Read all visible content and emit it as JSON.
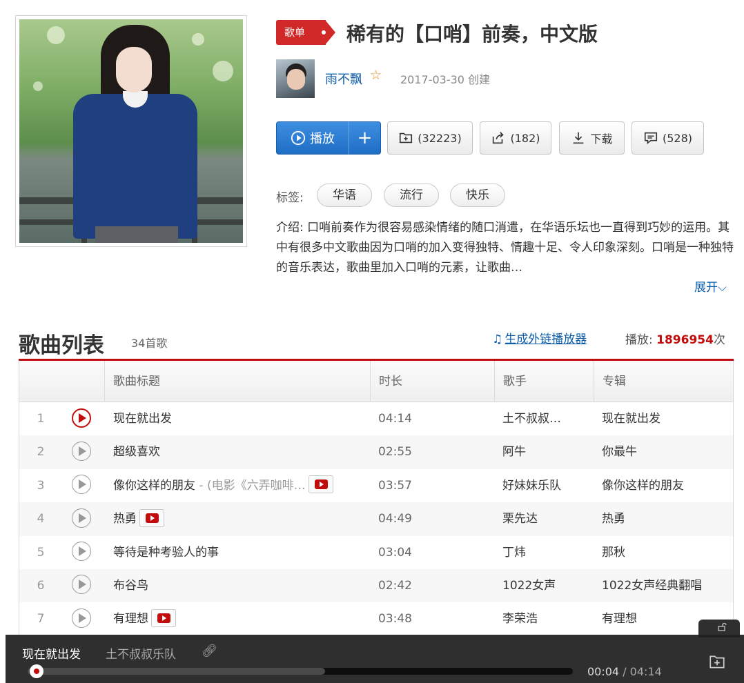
{
  "playlist": {
    "badge": "歌单",
    "title": "稀有的【口哨】前奏，中文版",
    "creator": {
      "name": "雨不飘",
      "created": "2017-03-30 创建"
    },
    "actions": {
      "play": "播放",
      "add": "+",
      "favorite": "(32223)",
      "share": "(182)",
      "download": "下载",
      "comment": "(528)"
    },
    "tags_label": "标签:",
    "tags": [
      "华语",
      "流行",
      "快乐"
    ],
    "intro": "介绍:  口哨前奏作为很容易感染情绪的随口消遣，在华语乐坛也一直得到巧妙的运用。其中有很多中文歌曲因为口哨的加入变得独特、情趣十足、令人印象深刻。口哨是一种独特的音乐表达，歌曲里加入口哨的元素，让歌曲…",
    "expand": "展开"
  },
  "song_list": {
    "title": "歌曲列表",
    "count": "34首歌",
    "gen_player": "生成外链播放器",
    "play_label": "播放:",
    "play_count": "1896954",
    "play_unit": "次",
    "headers": {
      "title": "歌曲标题",
      "duration": "时长",
      "artist": "歌手",
      "album": "专辑"
    },
    "rows": [
      {
        "idx": "1",
        "title": "现在就出发",
        "sub": "",
        "mv": false,
        "duration": "04:14",
        "artist": "土不叔叔…",
        "album": "现在就出发"
      },
      {
        "idx": "2",
        "title": "超级喜欢",
        "sub": "",
        "mv": false,
        "duration": "02:55",
        "artist": "阿牛",
        "album": "你最牛"
      },
      {
        "idx": "3",
        "title": "像你这样的朋友",
        "sub": " - (电影《六弄咖啡…",
        "mv": true,
        "duration": "03:57",
        "artist": "好妹妹乐队",
        "album": "像你这样的朋友"
      },
      {
        "idx": "4",
        "title": "热勇",
        "sub": "",
        "mv": true,
        "duration": "04:49",
        "artist": "栗先达",
        "album": "热勇"
      },
      {
        "idx": "5",
        "title": "等待是种考验人的事",
        "sub": "",
        "mv": false,
        "duration": "03:04",
        "artist": "丁炜",
        "album": "那秋"
      },
      {
        "idx": "6",
        "title": "布谷鸟",
        "sub": "",
        "mv": false,
        "duration": "02:42",
        "artist": "1022女声",
        "album": "1022女声经典翻唱"
      },
      {
        "idx": "7",
        "title": "有理想",
        "sub": "",
        "mv": true,
        "duration": "03:48",
        "artist": "李荣浩",
        "album": "有理想"
      }
    ]
  },
  "player": {
    "song": "现在就出发",
    "artist": "土不叔叔乐队",
    "current": "00:04",
    "total": "/ 04:14",
    "progress_fraction": 0.016,
    "buffer_fraction": 0.545
  },
  "colors": {
    "accent_red": "#c20c0c",
    "link_blue": "#0c5ca8",
    "play_blue": "#2a7ad2"
  },
  "icons": {
    "play": "play-circle-icon",
    "favorite": "folder-plus-icon",
    "share": "share-icon",
    "download": "download-icon",
    "comment": "comment-icon",
    "mv": "mv-icon",
    "star": "star-icon",
    "note": "music-note-icon",
    "link": "link-icon",
    "lock": "lock-icon"
  }
}
